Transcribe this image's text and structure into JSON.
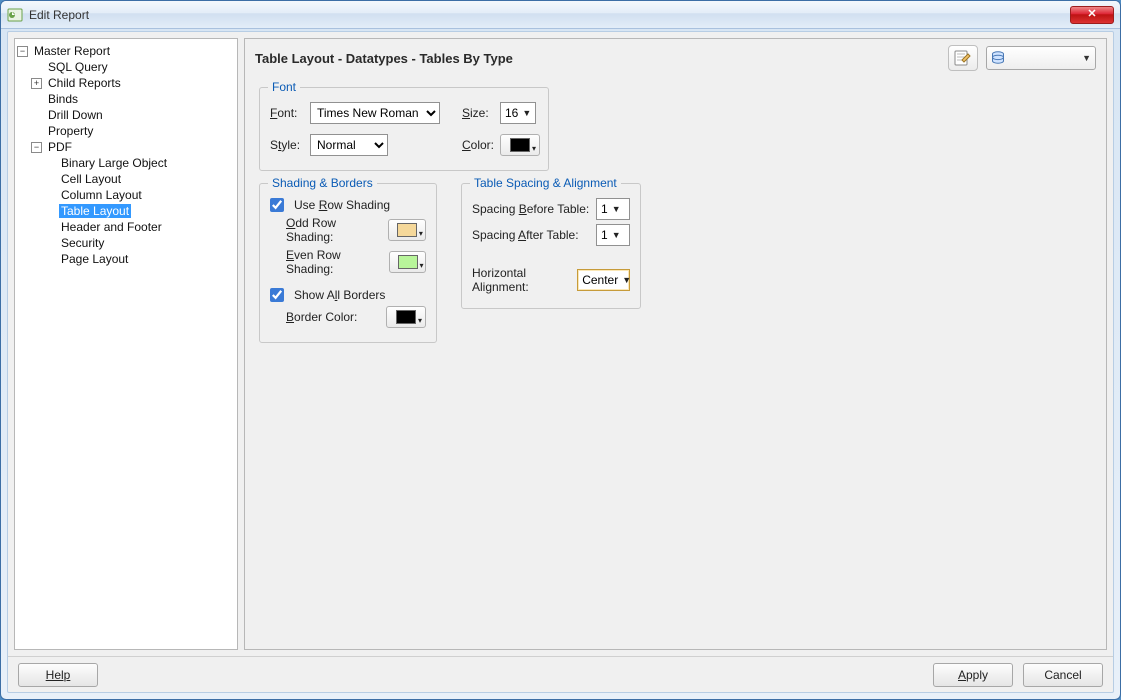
{
  "window": {
    "title": "Edit Report"
  },
  "tree": {
    "root": {
      "label": "Master Report",
      "children_a": [
        {
          "label": "SQL Query"
        },
        {
          "label": "Child Reports",
          "expandable": true
        },
        {
          "label": "Binds"
        },
        {
          "label": "Drill Down"
        },
        {
          "label": "Property"
        }
      ],
      "pdf": {
        "label": "PDF",
        "children": [
          {
            "label": "Binary Large Object"
          },
          {
            "label": "Cell Layout"
          },
          {
            "label": "Column Layout"
          },
          {
            "label": "Table Layout",
            "selected": true
          },
          {
            "label": "Header and Footer"
          },
          {
            "label": "Security"
          },
          {
            "label": "Page Layout"
          }
        ]
      }
    }
  },
  "right": {
    "title": "Table Layout - Datatypes - Tables By Type",
    "font_group": {
      "legend": "Font",
      "font_label": "Font:",
      "font_value": "Times New Roman",
      "size_label": "Size:",
      "size_value": "16",
      "style_label": "Style:",
      "style_value": "Normal",
      "color_label": "Color:",
      "color_value": "#000000"
    },
    "shading_group": {
      "legend": "Shading & Borders",
      "use_row_shading_label": "Use Row Shading",
      "use_row_shading_checked": true,
      "odd_label": "Odd Row Shading:",
      "odd_color": "#f5d89a",
      "even_label": "Even Row Shading:",
      "even_color": "#b8f59a",
      "show_all_borders_label": "Show All Borders",
      "show_all_borders_checked": true,
      "border_color_label": "Border Color:",
      "border_color": "#000000"
    },
    "spacing_group": {
      "legend": "Table Spacing & Alignment",
      "before_label": "Spacing Before Table:",
      "before_value": "1",
      "after_label": "Spacing After Table:",
      "after_value": "1",
      "halign_label": "Horizontal Alignment:",
      "halign_value": "Center"
    }
  },
  "buttons": {
    "help": "Help",
    "apply": "Apply",
    "cancel": "Cancel"
  }
}
